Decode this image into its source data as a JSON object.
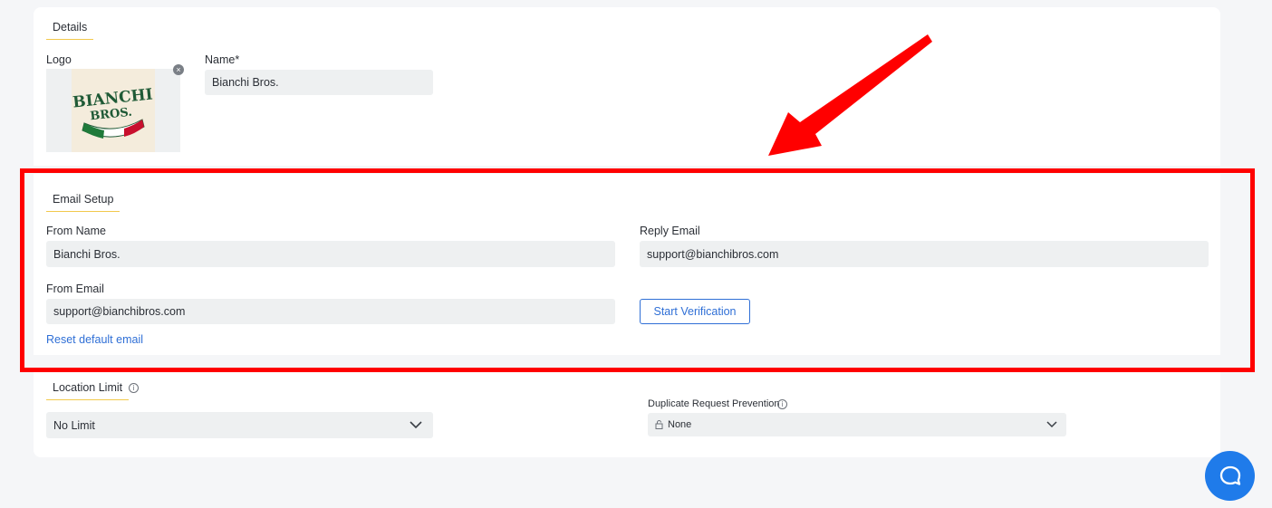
{
  "details": {
    "section_title": "Details",
    "logo_label": "Logo",
    "logo_text_line1": "BIANCHI",
    "logo_text_line2": "BROS.",
    "remove_logo_glyph": "×",
    "name_label": "Name*",
    "name_value": "Bianchi Bros."
  },
  "email_setup": {
    "section_title": "Email Setup",
    "from_name_label": "From Name",
    "from_name_value": "Bianchi Bros.",
    "reply_email_label": "Reply Email",
    "reply_email_value": "support@bianchibros.com",
    "from_email_label": "From Email",
    "from_email_value": "support@bianchibros.com",
    "start_verification_label": "Start Verification",
    "reset_link_label": "Reset default email"
  },
  "location": {
    "section_title": "Location Limit",
    "selected": "No Limit"
  },
  "duplicate": {
    "label": "Duplicate Request Prevention",
    "selected": "None"
  },
  "annotation": {
    "highlight_color": "#ff0000"
  },
  "colors": {
    "accent": "#2f6fd6",
    "underline": "#f2c94c",
    "chat": "#1f7bea"
  }
}
